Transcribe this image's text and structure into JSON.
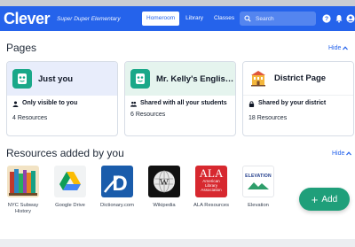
{
  "app": {
    "logo": "Clever",
    "school_name": "Super Duper Elementary"
  },
  "nav": {
    "tabs": [
      "Homeroom",
      "Library",
      "Classes"
    ],
    "active": "Homeroom"
  },
  "search": {
    "placeholder": "Search"
  },
  "toolbar_icons": [
    "help-icon",
    "bell-icon",
    "user-icon",
    "chevron-down-icon"
  ],
  "pages_section": {
    "title": "Pages",
    "hide_label": "Hide",
    "cards": [
      {
        "title": "Just you",
        "visibility": "Only visible to you",
        "count": "4 Resources",
        "header_color": "#e8edfb",
        "icon": "flashcard-app-icon"
      },
      {
        "title": "Mr. Kelly's English…",
        "visibility": "Shared with all your students",
        "count": "6 Resources",
        "header_color": "#e5f4ee",
        "icon": "flashcard-app-icon"
      },
      {
        "title": "District Page",
        "visibility": "Shared by your district",
        "count": "18 Resources",
        "header_color": "#ffffff",
        "icon": "building-icon"
      }
    ]
  },
  "resources_section": {
    "title": "Resources added by you",
    "hide_label": "Hide",
    "items": [
      {
        "label": "NYC Subway History",
        "icon": "books-icon"
      },
      {
        "label": "Google Drive",
        "icon": "google-drive-icon"
      },
      {
        "label": "Dictionary.com",
        "icon": "dictionary-icon"
      },
      {
        "label": "Wikipedia",
        "icon": "wikipedia-icon"
      },
      {
        "label": "ALA Resources",
        "icon": "ala-icon",
        "logo_lines": [
          "ALA",
          "American",
          "Library",
          "Association"
        ]
      },
      {
        "label": "Elevation",
        "icon": "elevation-icon",
        "logo_text": "ELEVATION"
      }
    ]
  },
  "add_button": {
    "label": "Add"
  },
  "colors": {
    "brand": "#2563eb",
    "add": "#1f9f7a"
  }
}
